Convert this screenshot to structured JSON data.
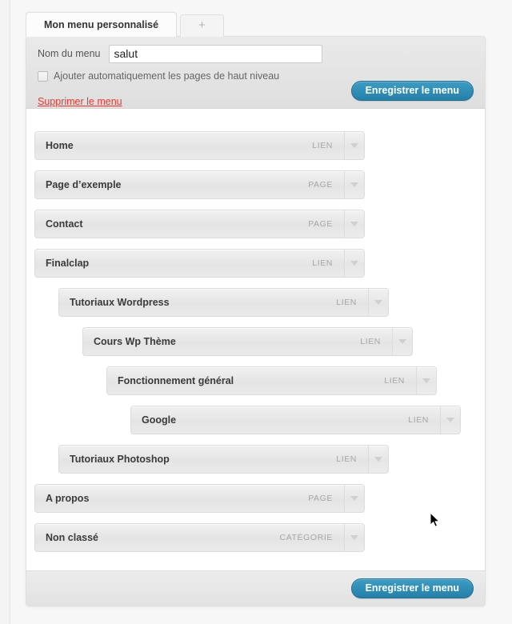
{
  "tabs": [
    {
      "label": "Mon menu personnalisé",
      "active": true,
      "name": "tab-mon-menu-personnalise"
    },
    {
      "label": "+",
      "active": false,
      "name": "tab-add-menu"
    }
  ],
  "header": {
    "menu_name_label": "Nom du menu",
    "menu_name_value": "salut",
    "menu_name_placeholder": "",
    "auto_add_label": "Ajouter automatiquement les pages de haut niveau",
    "auto_add_checked": false,
    "delete_link": "Supprimer le menu",
    "save_label": "Enregistrer le menu"
  },
  "footer": {
    "save_label": "Enregistrer le menu"
  },
  "colors": {
    "accent": "#2580a8",
    "danger": "#e8382f",
    "item_text": "#3b3b3b",
    "type_label": "#a6a6a6"
  },
  "menu_items": [
    {
      "title": "Home",
      "type": "LIEN",
      "depth": 0
    },
    {
      "title": "Page d’exemple",
      "type": "PAGE",
      "depth": 0
    },
    {
      "title": "Contact",
      "type": "PAGE",
      "depth": 0
    },
    {
      "title": "Finalclap",
      "type": "LIEN",
      "depth": 0
    },
    {
      "title": "Tutoriaux Wordpress",
      "type": "LIEN",
      "depth": 1
    },
    {
      "title": "Cours Wp Thème",
      "type": "LIEN",
      "depth": 2
    },
    {
      "title": "Fonctionnement général",
      "type": "LIEN",
      "depth": 3
    },
    {
      "title": "Google",
      "type": "LIEN",
      "depth": 4
    },
    {
      "title": "Tutoriaux Photoshop",
      "type": "LIEN",
      "depth": 1
    },
    {
      "title": "A propos",
      "type": "PAGE",
      "depth": 0
    },
    {
      "title": "Non classé",
      "type": "CATÉGORIE",
      "depth": 0
    }
  ]
}
